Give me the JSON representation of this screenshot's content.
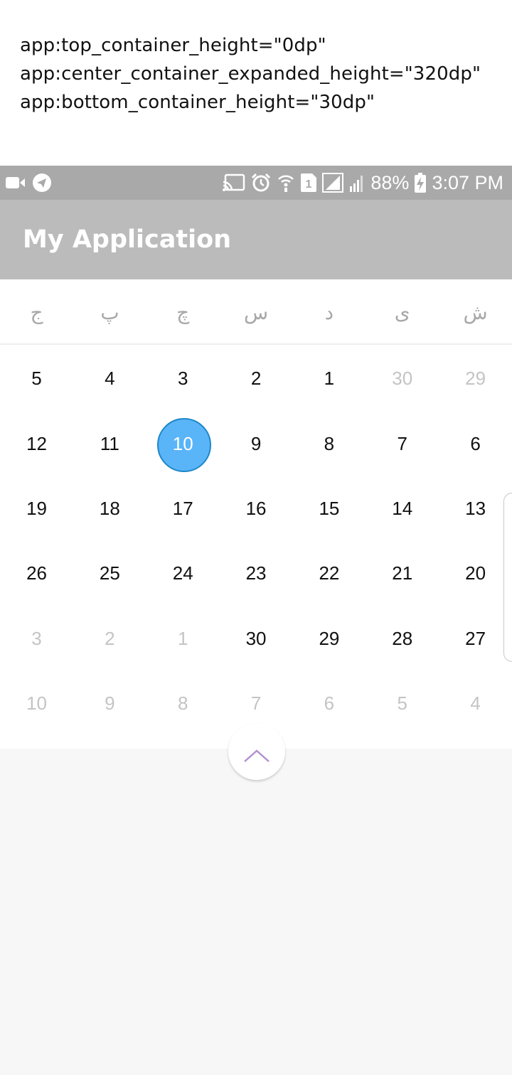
{
  "caption": {
    "lines": [
      "app:top_container_height=\"0dp\"",
      "app:center_container_expanded_height=\"320dp\"",
      "app:bottom_container_height=\"30dp\""
    ]
  },
  "status_bar": {
    "left_icons": [
      "video-camera-icon",
      "telegram-icon"
    ],
    "right_icons": [
      "cast-icon",
      "alarm-icon",
      "wifi-calling-icon",
      "sim-1-icon",
      "signal-icon",
      "signal-weak-icon",
      "battery-charging-icon"
    ],
    "battery_percent": "88%",
    "time": "3:07 PM"
  },
  "app_bar": {
    "title": "My Application"
  },
  "calendar": {
    "weekdays": [
      "ش",
      "ی",
      "د",
      "س",
      "چ",
      "پ",
      "ج"
    ],
    "weeks": [
      [
        {
          "d": "29",
          "m": true
        },
        {
          "d": "30",
          "m": true
        },
        {
          "d": "1"
        },
        {
          "d": "2"
        },
        {
          "d": "3"
        },
        {
          "d": "4"
        },
        {
          "d": "5"
        }
      ],
      [
        {
          "d": "6"
        },
        {
          "d": "7"
        },
        {
          "d": "8"
        },
        {
          "d": "9"
        },
        {
          "d": "10",
          "s": true
        },
        {
          "d": "11"
        },
        {
          "d": "12"
        }
      ],
      [
        {
          "d": "13"
        },
        {
          "d": "14"
        },
        {
          "d": "15"
        },
        {
          "d": "16"
        },
        {
          "d": "17"
        },
        {
          "d": "18"
        },
        {
          "d": "19"
        }
      ],
      [
        {
          "d": "20"
        },
        {
          "d": "21"
        },
        {
          "d": "22"
        },
        {
          "d": "23"
        },
        {
          "d": "24"
        },
        {
          "d": "25"
        },
        {
          "d": "26"
        }
      ],
      [
        {
          "d": "27"
        },
        {
          "d": "28"
        },
        {
          "d": "29"
        },
        {
          "d": "30"
        },
        {
          "d": "1",
          "m": true
        },
        {
          "d": "2",
          "m": true
        },
        {
          "d": "3",
          "m": true
        }
      ],
      [
        {
          "d": "4",
          "m": true
        },
        {
          "d": "5",
          "m": true
        },
        {
          "d": "6",
          "m": true
        },
        {
          "d": "7",
          "m": true
        },
        {
          "d": "8",
          "m": true
        },
        {
          "d": "9",
          "m": true
        },
        {
          "d": "10",
          "m": true
        }
      ]
    ],
    "selected_color": "#5ab4f8"
  },
  "collapse_button": {
    "icon": "chevron-up-icon",
    "color": "#b48fd0"
  }
}
